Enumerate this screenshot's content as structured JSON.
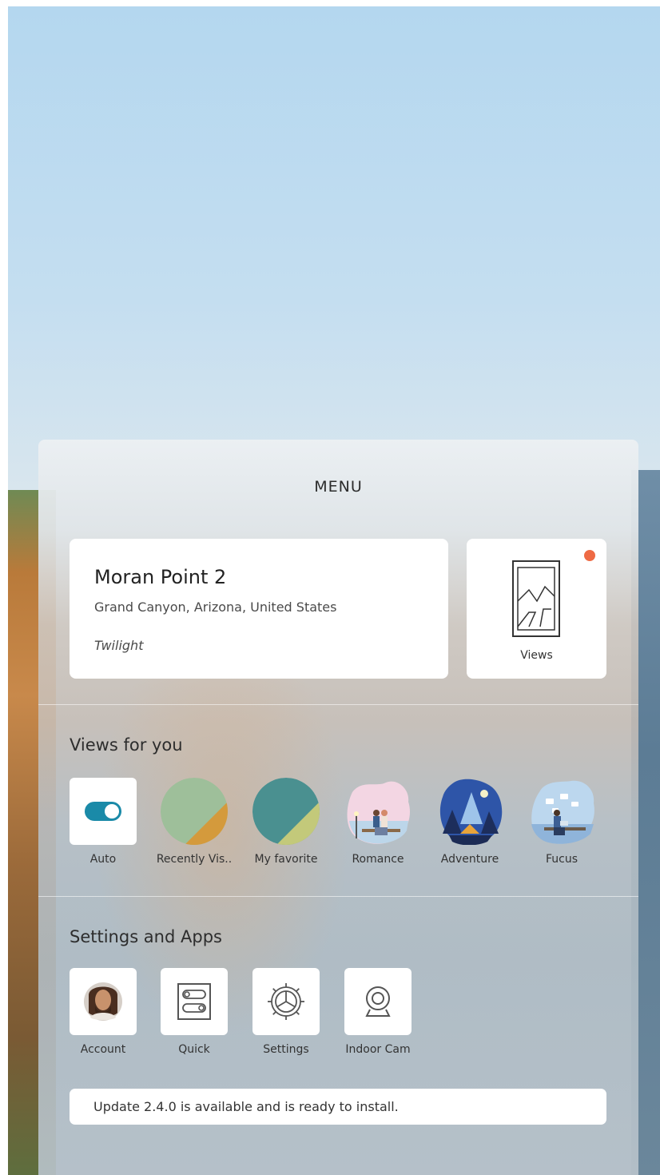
{
  "menu": {
    "title": "MENU"
  },
  "location": {
    "name": "Moran Point 2",
    "region": "Grand Canyon, Arizona, United States",
    "time_of_day": "Twilight"
  },
  "views_button": {
    "label": "Views",
    "has_notification": true
  },
  "views_for_you": {
    "title": "Views for you",
    "items": [
      {
        "label": "Auto",
        "icon": "toggle-icon"
      },
      {
        "label": "Recently Vis..",
        "icon": "recently-visited-icon"
      },
      {
        "label": "My favorite",
        "icon": "favorite-icon"
      },
      {
        "label": "Romance",
        "icon": "romance-icon"
      },
      {
        "label": "Adventure",
        "icon": "adventure-icon"
      },
      {
        "label": "Fucus",
        "icon": "focus-icon"
      }
    ]
  },
  "settings_and_apps": {
    "title": "Settings and Apps",
    "items": [
      {
        "label": "Account",
        "icon": "avatar-icon"
      },
      {
        "label": "Quick",
        "icon": "quick-toggles-icon"
      },
      {
        "label": "Settings",
        "icon": "gear-icon"
      },
      {
        "label": "Indoor Cam",
        "icon": "webcam-icon"
      }
    ]
  },
  "update": {
    "message": "Update 2.4.0 is available and is ready to install."
  },
  "colors": {
    "accent": "#1a8aa8",
    "notification": "#ee6a44",
    "panel_text": "#2d2d2d"
  }
}
